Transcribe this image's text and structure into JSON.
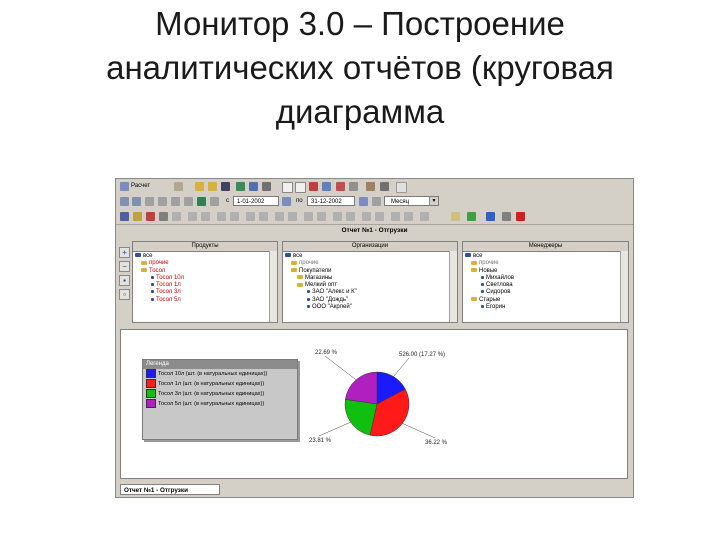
{
  "slide": {
    "title_lines": [
      "Монитор 3.0 – Построение",
      "аналитических отчётов (круговая",
      "диаграмма"
    ]
  },
  "toolbar": {
    "raschet_label": "Расчет",
    "date_label_from": "с",
    "date_from": "1-01-2002",
    "date_label_to": "по",
    "date_to": "31-12-2002",
    "period": "Месяц"
  },
  "report": {
    "caption": "Отчет №1 - Отгрузки",
    "bottom_tab": "Отчет №1 - Отгрузки"
  },
  "panels": {
    "products": {
      "header": "Продукты",
      "nodes": [
        "все",
        "прочие",
        "Тосол",
        "Тосол 10л",
        "Тосол 1л",
        "Тосол 3л",
        "Тосол 5л"
      ]
    },
    "orgs": {
      "header": "Организации",
      "nodes": [
        "все",
        "прочие",
        "Покупатели",
        "Магазины",
        "Мелкий опт",
        "ЗАО \"Алекс и К\"",
        "ЗАО \"Дождь\"",
        "ООО \"Акрлей\""
      ]
    },
    "managers": {
      "header": "Менеджеры",
      "nodes": [
        "все",
        "прочие",
        "Новые",
        "Михайлов",
        "Светлова",
        "Сидоров",
        "Старые",
        "Егорин"
      ]
    }
  },
  "legend": {
    "title": "Легенда",
    "items": [
      {
        "label": "Тосол 10л (шт. (в натуральных единицах))",
        "color": "#1a1aff"
      },
      {
        "label": "Тосол 1л (шт. (в натуральных единицах))",
        "color": "#ff1a1a"
      },
      {
        "label": "Тосол 3л (шт. (в натуральных единицах))",
        "color": "#10c010"
      },
      {
        "label": "Тосол 5л (шт. (в натуральных единицах))",
        "color": "#b020c0"
      }
    ]
  },
  "chart_data": {
    "type": "pie",
    "slices": [
      {
        "name": "Тосол 10л",
        "value": 17.27,
        "label": "526.00 (17.27 %)",
        "color": "#1a1aff"
      },
      {
        "name": "Тосол 1л",
        "value": 36.22,
        "label": "36.22 %",
        "color": "#ff1a1a"
      },
      {
        "name": "Тосол 3л",
        "value": 23.81,
        "label": "23.81 %",
        "color": "#10c010"
      },
      {
        "name": "Тосол 5л",
        "value": 22.69,
        "label": "22.69 %",
        "color": "#b020c0"
      }
    ]
  }
}
